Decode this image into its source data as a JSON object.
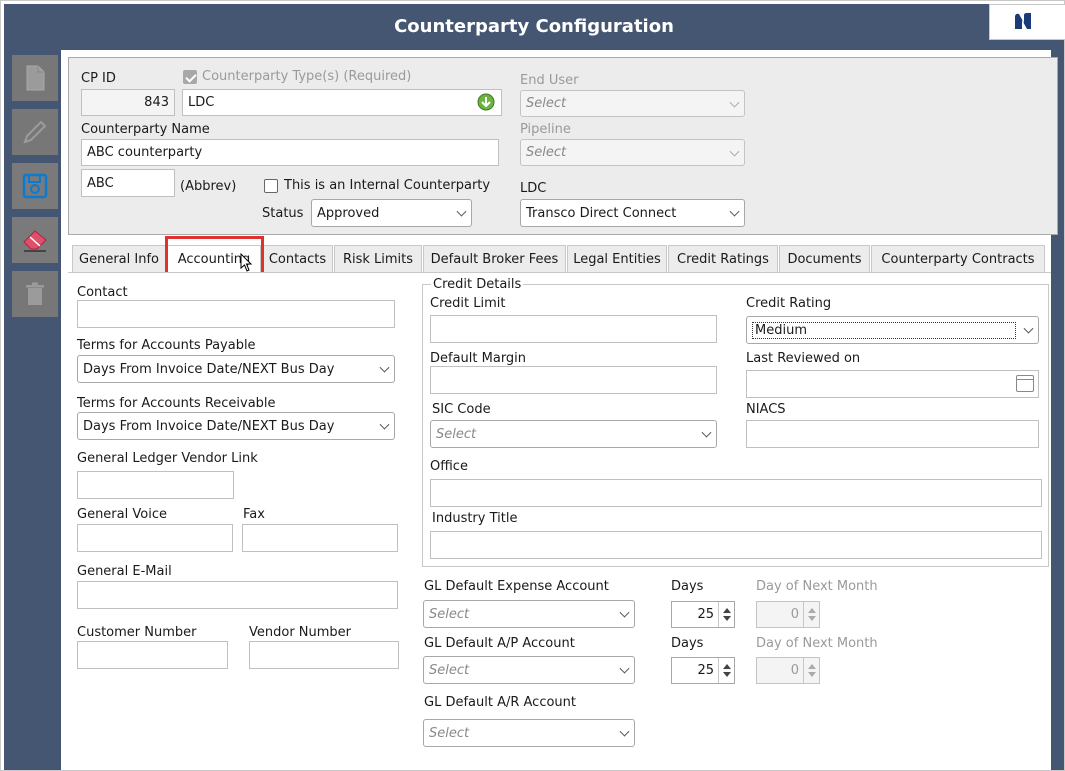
{
  "window": {
    "title": "Counterparty Configuration"
  },
  "colors": {
    "titlebar": "#455673",
    "tab_highlight": "#e03030",
    "toolbar_button": "#777777",
    "save_icon": "#0a7bd1",
    "eraser_icon": "#e0506a"
  },
  "toolbar": [
    {
      "name": "new-document-icon"
    },
    {
      "name": "edit-pencil-icon"
    },
    {
      "name": "save-icon"
    },
    {
      "name": "eraser-icon"
    },
    {
      "name": "trash-icon"
    }
  ],
  "header": {
    "cp_id_label": "CP ID",
    "cp_id_value": "843",
    "cp_type_label": "Counterparty Type(s) (Required)",
    "cp_type_value": "LDC",
    "cp_name_label": "Counterparty Name",
    "cp_name_value": "ABC counterparty",
    "abbrev_value": "ABC",
    "abbrev_label": "(Abbrev)",
    "internal_label": "This is an Internal Counterparty",
    "status_label": "Status",
    "status_value": "Approved",
    "end_user_label": "End User",
    "end_user_value": "Select",
    "pipeline_label": "Pipeline",
    "pipeline_value": "Select",
    "ldc_label": "LDC",
    "ldc_value": "Transco Direct Connect"
  },
  "tabs": [
    {
      "label": "General Info",
      "active": false
    },
    {
      "label": "Accounting",
      "active": true
    },
    {
      "label": "Contacts",
      "active": false
    },
    {
      "label": "Risk Limits",
      "active": false
    },
    {
      "label": "Default Broker Fees",
      "active": false
    },
    {
      "label": "Legal Entities",
      "active": false
    },
    {
      "label": "Credit Ratings",
      "active": false
    },
    {
      "label": "Documents",
      "active": false
    },
    {
      "label": "Counterparty Contracts",
      "active": false
    }
  ],
  "accounting": {
    "contact_label": "Contact",
    "contact_value": "",
    "terms_ap_label": "Terms for Accounts Payable",
    "terms_ap_value": "Days From Invoice Date/NEXT Bus Day",
    "terms_ar_label": "Terms for Accounts Receivable",
    "terms_ar_value": "Days From Invoice Date/NEXT Bus Day",
    "gl_vendor_label": "General Ledger Vendor Link",
    "voice_label": "General Voice",
    "fax_label": "Fax",
    "email_label": "General E-Mail",
    "customer_label": "Customer Number",
    "vendor_label": "Vendor Number",
    "credit": {
      "group_label": "Credit Details",
      "limit_label": "Credit Limit",
      "rating_label": "Credit Rating",
      "rating_value": "Medium",
      "margin_label": "Default Margin",
      "reviewed_label": "Last Reviewed on",
      "sic_label": "SIC Code",
      "sic_value": "Select",
      "niacs_label": "NIACS",
      "office_label": "Office",
      "industry_label": "Industry Title"
    },
    "gl": {
      "expense_label": "GL Default Expense Account",
      "expense_value": "Select",
      "ap_label": "GL Default A/P Account",
      "ap_value": "Select",
      "ar_label": "GL Default A/R Account",
      "ar_value": "Select",
      "days_label": "Days",
      "days_value_1": "25",
      "days_value_2": "25",
      "next_month_label": "Day of Next Month",
      "next_month_value_1": "0",
      "next_month_value_2": "0"
    }
  }
}
